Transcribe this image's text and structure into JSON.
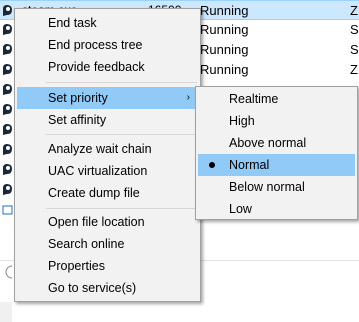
{
  "rows": [
    {
      "name": "steam.exe",
      "pid": "16500",
      "status": "Running",
      "user": "Z",
      "selected": true
    },
    {
      "name": "",
      "pid": "",
      "status": "Running",
      "user": "S",
      "selected": false
    },
    {
      "name": "",
      "pid": "",
      "status": "Running",
      "user": "S",
      "selected": false
    },
    {
      "name": "",
      "pid": "",
      "status": "Running",
      "user": "Z",
      "selected": false
    },
    {
      "name": "",
      "pid": "",
      "status": "",
      "user": "",
      "selected": false
    }
  ],
  "menu": {
    "items": [
      "End task",
      "End process tree",
      "Provide feedback",
      "Set priority",
      "Set affinity",
      "Analyze wait chain",
      "UAC virtualization",
      "Create dump file",
      "Open file location",
      "Search online",
      "Properties",
      "Go to service(s)"
    ],
    "highlighted": "Set priority"
  },
  "submenu": {
    "items": [
      "Realtime",
      "High",
      "Above normal",
      "Normal",
      "Below normal",
      "Low"
    ],
    "selected": "Normal"
  },
  "colors": {
    "highlight": "#91c9f7",
    "row_selected": "#cce8ff",
    "menu_bg": "#f2f2f2"
  }
}
